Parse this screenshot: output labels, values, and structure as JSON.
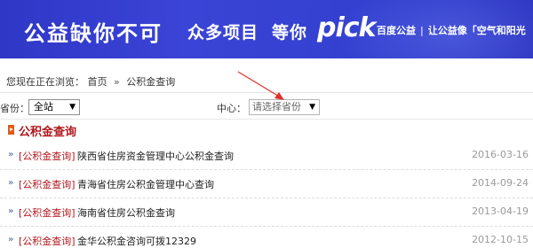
{
  "banner": {
    "slogan_1": "公益缺你不可",
    "slogan_2": "众多项目",
    "slogan_3": "等你",
    "logo_text": "pick",
    "site_name": "百度公益",
    "separator": "|",
    "tagline": "让公益像「空气和阳光"
  },
  "breadcrumb": {
    "prefix": "您现在正在浏览：",
    "items": [
      "首页",
      "公积金查询"
    ],
    "separator": "»"
  },
  "filters": {
    "province_label": "省份：",
    "province_value": "全站",
    "center_label": "中心：",
    "center_placeholder": "请选择省份"
  },
  "section": {
    "title": "公积金查询"
  },
  "list": [
    {
      "tag": "[公积金查询]",
      "title": "陕西省住房资金管理中心公积金查询",
      "date": "2016-03-16"
    },
    {
      "tag": "[公积金查询]",
      "title": "青海省住房公积金管理中心查询",
      "date": "2014-09-24"
    },
    {
      "tag": "[公积金查询]",
      "title": "海南省住房公积金查询",
      "date": "2013-04-19"
    },
    {
      "tag": "[公积金查询]",
      "title": "金华公积金咨询可拨12329",
      "date": "2012-10-15"
    }
  ],
  "icons": {
    "bullet": "double-chevron-right-icon",
    "section_marker": "play-arrow-icon",
    "dropdown": "triangle-down-icon"
  },
  "colors": {
    "banner_bg": "#3340cf",
    "tag_red": "#b0171c",
    "annotation_red": "#e0302a",
    "date_gray": "#9a9a9a"
  }
}
